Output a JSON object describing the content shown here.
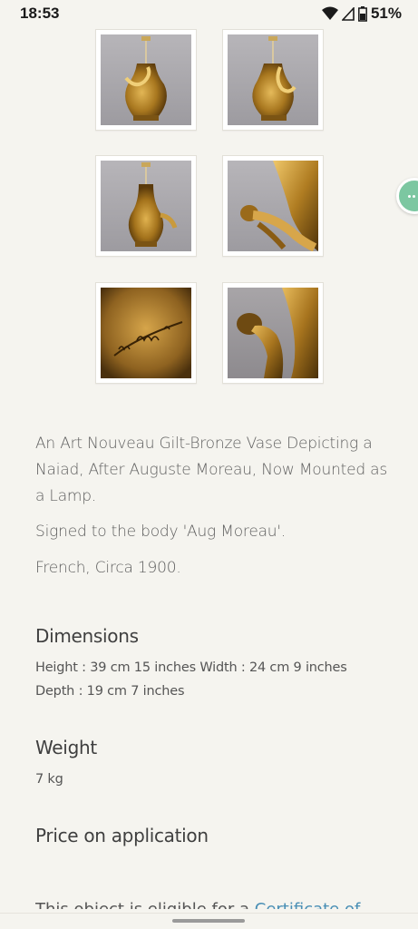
{
  "status": {
    "time": "18:53",
    "battery": "51%"
  },
  "gallery": {
    "thumbnails": [
      {
        "name": "vase-front",
        "style": "grey"
      },
      {
        "name": "vase-side",
        "style": "grey"
      },
      {
        "name": "vase-back",
        "style": "grey"
      },
      {
        "name": "figure-detail",
        "style": "grey"
      },
      {
        "name": "signature-detail",
        "style": "dark"
      },
      {
        "name": "naiad-detail",
        "style": "dark"
      }
    ]
  },
  "description": {
    "title": "An Art Nouveau Gilt-Bronze Vase Depicting a Naiad, After Auguste Moreau, Now Mounted as a Lamp.",
    "signed": "Signed to the body 'Aug Moreau'.",
    "origin": "French, Circa 1900."
  },
  "dimensions": {
    "heading": "Dimensions",
    "line1": "Height : 39 cm 15 inches Width : 24 cm 9 inches",
    "line2": "Depth : 19 cm 7 inches"
  },
  "weight": {
    "heading": "Weight",
    "value": "7 kg"
  },
  "price": {
    "text": "Price on application"
  },
  "certificate": {
    "text": "This object is eligible for a ",
    "link": "Certificate of"
  },
  "colors": {
    "background": "#f5f4ef",
    "accent_link": "#4a8fb5",
    "chat_fab": "#7cc7a1",
    "gilt": "#b8862e"
  }
}
